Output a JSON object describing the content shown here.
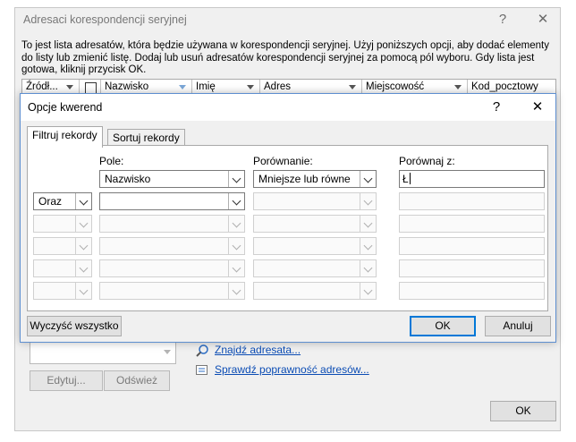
{
  "background_dialog": {
    "title": "Adresaci korespondencji seryjnej",
    "help_glyph": "?",
    "close_glyph": "✕",
    "intro_text": "To jest lista adresatów, która będzie używana w korespondencji seryjnej. Użyj poniższych opcji, aby dodać elementy do listy lub zmienić listę. Dodaj lub usuń adresatów korespondencji seryjnej za pomocą pól wyboru. Gdy lista jest gotowa, kliknij przycisk OK.",
    "columns": [
      "Źródł...",
      "",
      "Nazwisko",
      "Imię",
      "Adres",
      "Miejscowość",
      "Kod_pocztowy"
    ],
    "edit_button": "Edytuj...",
    "refresh_button": "Odśwież",
    "find_recipient_link": "Znajdź adresata...",
    "validate_addresses_link": "Sprawdź poprawność adresów...",
    "ok_button": "OK"
  },
  "query_dialog": {
    "title": "Opcje kwerend",
    "help_glyph": "?",
    "close_glyph": "✕",
    "tabs": [
      {
        "label": "Filtruj rekordy",
        "active": true
      },
      {
        "label": "Sortuj rekordy",
        "active": false
      }
    ],
    "column_headers": {
      "field": "Pole:",
      "comparison": "Porównanie:",
      "compare_to": "Porównaj z:"
    },
    "rows": [
      {
        "conjunction": "",
        "field": "Nazwisko",
        "comparison": "Mniejsze lub równe",
        "compare_to": "Ł"
      },
      {
        "conjunction": "Oraz",
        "field": "",
        "comparison": "",
        "compare_to": ""
      },
      {
        "conjunction": "",
        "field": "",
        "comparison": "",
        "compare_to": ""
      },
      {
        "conjunction": "",
        "field": "",
        "comparison": "",
        "compare_to": ""
      },
      {
        "conjunction": "",
        "field": "",
        "comparison": "",
        "compare_to": ""
      },
      {
        "conjunction": "",
        "field": "",
        "comparison": "",
        "compare_to": ""
      }
    ],
    "clear_all_button": "Wyczyść wszystko",
    "ok_button": "OK",
    "cancel_button": "Anuluj"
  }
}
